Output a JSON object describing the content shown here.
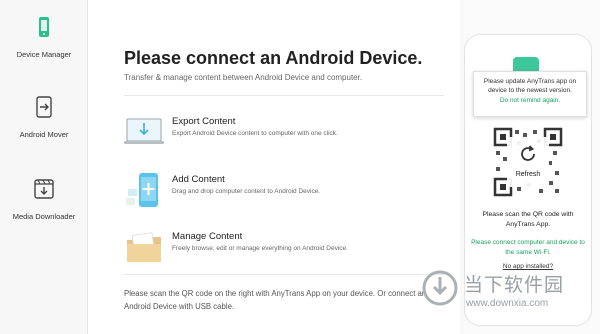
{
  "sidebar": {
    "items": [
      {
        "label": "Device Manager",
        "icon": "phone-icon"
      },
      {
        "label": "Android Mover",
        "icon": "mover-icon"
      },
      {
        "label": "Media Downloader",
        "icon": "download-icon"
      }
    ]
  },
  "main": {
    "title": "Please connect an Android Device.",
    "subtitle": "Transfer & manage content between Android Device and computer.",
    "features": [
      {
        "name": "Export Content",
        "desc": "Export Android Device content to computer with one click.",
        "icon": "laptop-export-icon"
      },
      {
        "name": "Add Content",
        "desc": "Drag and drop computer content to Android Device.",
        "icon": "phone-add-icon"
      },
      {
        "name": "Manage Content",
        "desc": "Freely browse, edit or manage everything on Android Device.",
        "icon": "folder-icon"
      }
    ],
    "bottom_note": "Please scan the QR code on the right with AnyTrans App on your device. Or connect an Android Device with USB cable."
  },
  "phone_panel": {
    "popup_message": "Please update AnyTrans app on device to the newest version.",
    "popup_link": "Do not remind again.",
    "refresh_label": "Refresh",
    "scan_text": "Please scan the QR code with AnyTrans App.",
    "wifi_text": "Please connect computer and device to the same Wi-Fi.",
    "no_app_link": "No app installed?"
  },
  "watermark": {
    "text": "当下软件园",
    "url": "www.downxia.com"
  },
  "colors": {
    "accent_green": "#1aa260",
    "teal": "#3ec79a",
    "sidebar_bg": "#f7f7f8"
  }
}
